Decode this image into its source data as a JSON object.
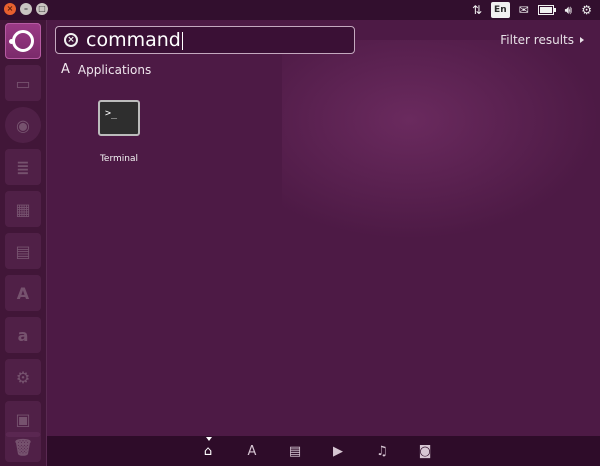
{
  "panel": {
    "lang": "En",
    "window_buttons": [
      "close",
      "minimize",
      "maximize"
    ],
    "indicators": [
      "network-icon",
      "keyboard-language",
      "mail-icon",
      "battery-icon",
      "volume-icon",
      "gear-icon"
    ]
  },
  "search": {
    "value": "command",
    "clear_icon": "×"
  },
  "filter": {
    "label": "Filter results"
  },
  "category": {
    "label": "Applications",
    "icon": "A"
  },
  "results": [
    {
      "name": "Terminal",
      "icon": "terminal-icon",
      "prompt": ">_"
    }
  ],
  "launcher": {
    "items": [
      "dash-home-icon",
      "files-icon",
      "firefox-icon",
      "libreoffice-writer-icon",
      "libreoffice-calc-icon",
      "libreoffice-impress-icon",
      "software-center-icon",
      "amazon-icon",
      "system-settings-icon",
      "workspace-switcher-icon",
      "trash-icon"
    ],
    "amazon_glyph": "a"
  },
  "lenses": [
    "home",
    "applications",
    "files",
    "video",
    "music",
    "photos"
  ],
  "colors": {
    "dash_background": "#4d1a45",
    "accent": "#9b3a86",
    "close_button": "#e8602f"
  }
}
